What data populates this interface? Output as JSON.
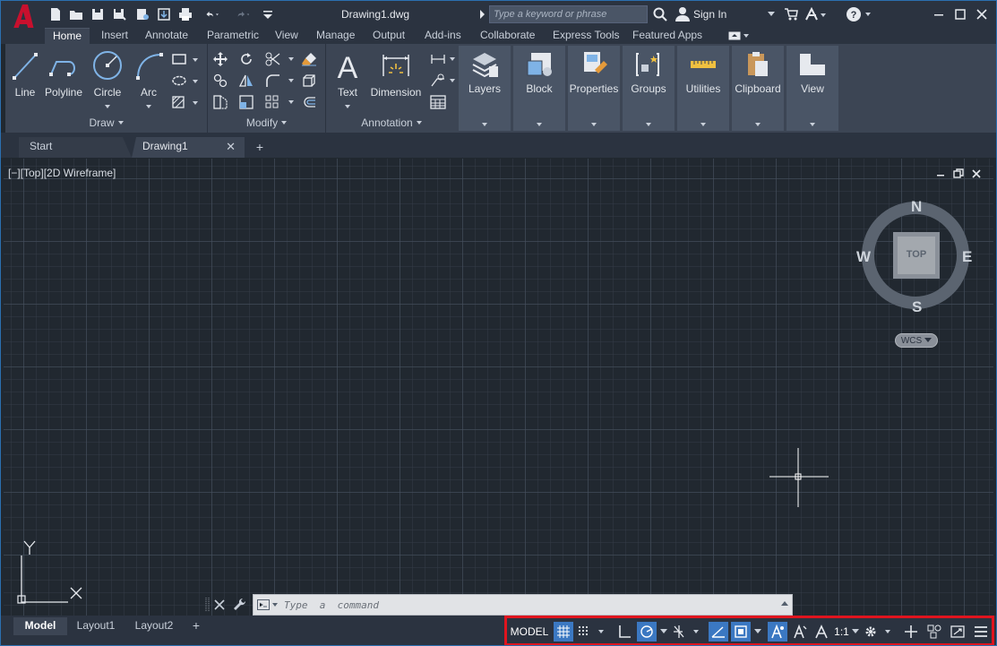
{
  "window": {
    "title": "Drawing1.dwg"
  },
  "titlebar": {
    "search_placeholder": "Type a keyword or phrase",
    "sign_in": "Sign In"
  },
  "ribbon_tabs": [
    "Home",
    "Insert",
    "Annotate",
    "Parametric",
    "View",
    "Manage",
    "Output",
    "Add-ins",
    "Collaborate",
    "Express Tools",
    "Featured Apps"
  ],
  "ribbon": {
    "draw": {
      "title": "Draw",
      "line": "Line",
      "polyline": "Polyline",
      "circle": "Circle",
      "arc": "Arc"
    },
    "modify": {
      "title": "Modify"
    },
    "annotation": {
      "title": "Annotation",
      "text": "Text",
      "dimension": "Dimension"
    },
    "groups": [
      "Layers",
      "Block",
      "Properties",
      "Groups",
      "Utilities",
      "Clipboard",
      "View"
    ]
  },
  "doc_tabs": {
    "start": "Start",
    "drawing": "Drawing1"
  },
  "viewport": {
    "label": "[−][Top][2D Wireframe]",
    "viewcube": {
      "north": "N",
      "south": "S",
      "east": "E",
      "west": "W",
      "top": "TOP",
      "wcs": "WCS"
    },
    "ucs": {
      "x": "X",
      "y": "Y"
    }
  },
  "command": {
    "placeholder": "Type  a  command"
  },
  "layout_tabs": [
    "Model",
    "Layout1",
    "Layout2"
  ],
  "statusbar": {
    "model": "MODEL",
    "scale": "1:1"
  },
  "colors": {
    "accent": "#3b78c2",
    "highlight_border": "#e0141e",
    "app_red": "#c8102e"
  }
}
